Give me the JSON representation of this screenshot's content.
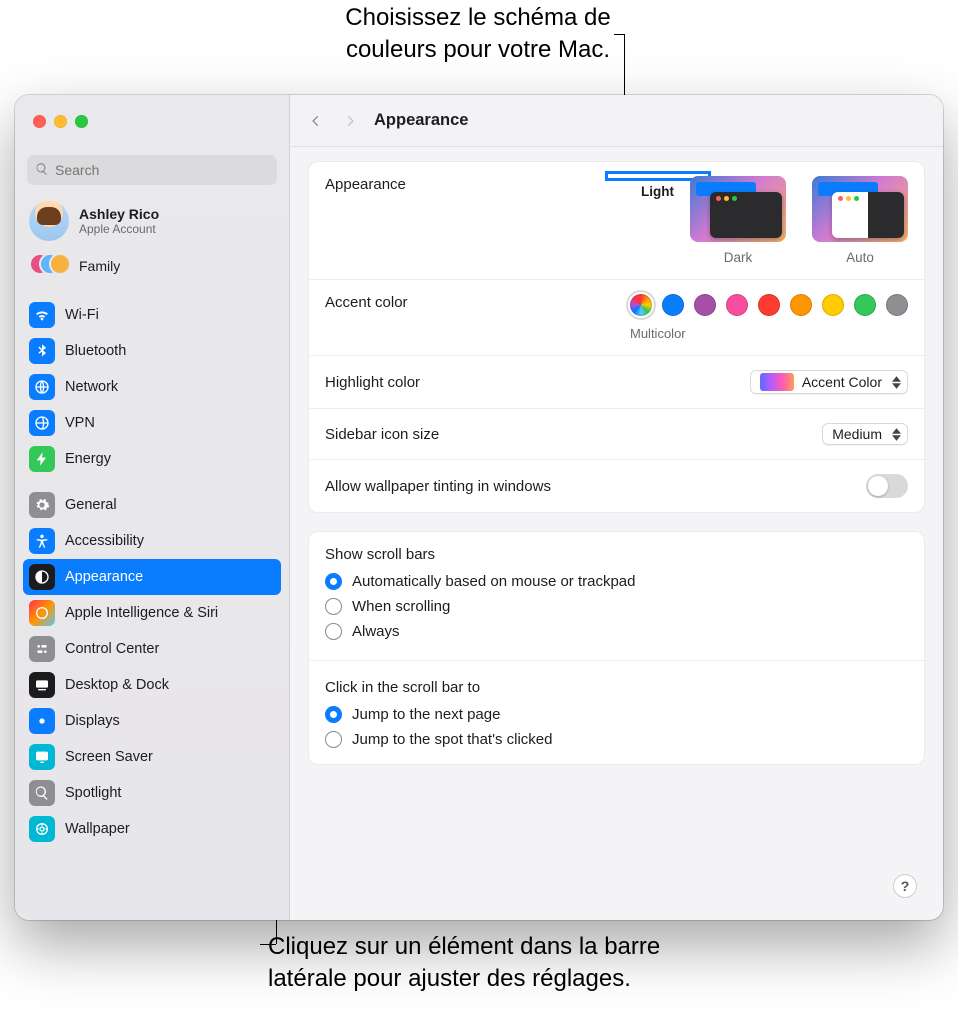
{
  "callouts": {
    "top": "Choisissez le schéma de\ncouleurs pour votre Mac.",
    "bottom": "Cliquez sur un élément dans la barre\nlatérale pour ajuster des réglages."
  },
  "search": {
    "placeholder": "Search"
  },
  "account": {
    "name": "Ashley Rico",
    "sub": "Apple Account"
  },
  "family": {
    "label": "Family"
  },
  "sidebar": {
    "group1": [
      {
        "id": "wifi",
        "label": "Wi-Fi",
        "bg": "#0a7dff"
      },
      {
        "id": "bluetooth",
        "label": "Bluetooth",
        "bg": "#0a7dff"
      },
      {
        "id": "network",
        "label": "Network",
        "bg": "#0a7dff"
      },
      {
        "id": "vpn",
        "label": "VPN",
        "bg": "#0a7dff"
      },
      {
        "id": "energy",
        "label": "Energy",
        "bg": "#34c759"
      }
    ],
    "group2": [
      {
        "id": "general",
        "label": "General",
        "bg": "#8e8e93"
      },
      {
        "id": "accessibility",
        "label": "Accessibility",
        "bg": "#0a7dff"
      },
      {
        "id": "appearance",
        "label": "Appearance",
        "bg": "#1c1c1e",
        "active": true
      },
      {
        "id": "siri",
        "label": "Apple Intelligence & Siri",
        "bg": "linear-gradient(135deg,#ff2d55,#ff9500,#5ac8fa)"
      },
      {
        "id": "control",
        "label": "Control Center",
        "bg": "#8e8e93"
      },
      {
        "id": "desktop",
        "label": "Desktop & Dock",
        "bg": "#1c1c1e"
      },
      {
        "id": "displays",
        "label": "Displays",
        "bg": "#0a7dff"
      },
      {
        "id": "screensaver",
        "label": "Screen Saver",
        "bg": "#00b8d4"
      },
      {
        "id": "spotlight",
        "label": "Spotlight",
        "bg": "#8e8e93"
      },
      {
        "id": "wallpaper",
        "label": "Wallpaper",
        "bg": "#00b8d4"
      }
    ]
  },
  "header": {
    "title": "Appearance"
  },
  "appearance": {
    "label": "Appearance",
    "options": [
      {
        "id": "light",
        "label": "Light",
        "selected": true
      },
      {
        "id": "dark",
        "label": "Dark"
      },
      {
        "id": "auto",
        "label": "Auto"
      }
    ]
  },
  "accent": {
    "label": "Accent color",
    "selected_label": "Multicolor",
    "colors": [
      "multi",
      "#0a7dff",
      "#a550a7",
      "#f74f9e",
      "#ff3b30",
      "#ff9500",
      "#ffcc00",
      "#34c759",
      "#8e8e93"
    ]
  },
  "highlight": {
    "label": "Highlight color",
    "value": "Accent Color"
  },
  "sidebar_size": {
    "label": "Sidebar icon size",
    "value": "Medium"
  },
  "tinting": {
    "label": "Allow wallpaper tinting in windows",
    "on": false
  },
  "scrollbars": {
    "title": "Show scroll bars",
    "options": [
      {
        "label": "Automatically based on mouse or trackpad",
        "selected": true
      },
      {
        "label": "When scrolling"
      },
      {
        "label": "Always"
      }
    ]
  },
  "scrollclick": {
    "title": "Click in the scroll bar to",
    "options": [
      {
        "label": "Jump to the next page",
        "selected": true
      },
      {
        "label": "Jump to the spot that's clicked"
      }
    ]
  },
  "help": "?"
}
